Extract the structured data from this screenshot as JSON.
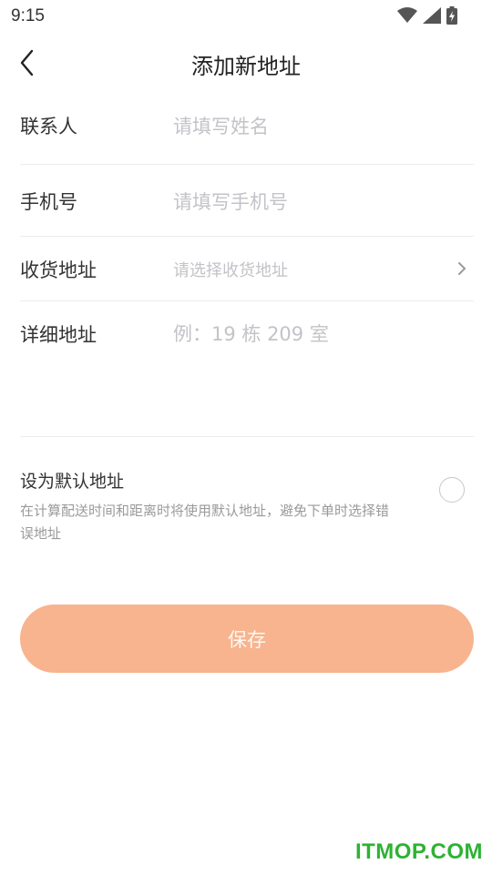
{
  "status_bar": {
    "time": "9:15",
    "icons": [
      "wifi-icon",
      "signal-icon",
      "battery-charging-icon"
    ]
  },
  "header": {
    "back_icon": "chevron-left-icon",
    "title": "添加新地址"
  },
  "form": {
    "name": {
      "label": "联系人",
      "placeholder": "请填写姓名",
      "value": ""
    },
    "phone": {
      "label": "手机号",
      "placeholder": "请填写手机号",
      "value": ""
    },
    "region": {
      "label": "收货地址",
      "placeholder": "请选择收货地址",
      "icon": "chevron-right-icon"
    },
    "detail": {
      "label": "详细地址",
      "placeholder": "例：19 栋 209 室",
      "value": ""
    }
  },
  "default_address": {
    "title": "设为默认地址",
    "description": "在计算配送时间和距离时将使用默认地址，避免下单时选择错误地址",
    "checked": false
  },
  "save_button": {
    "label": "保存",
    "color": "#f7b48e"
  },
  "watermark": "ITMOP.COM",
  "colors": {
    "accent": "#f7b48e",
    "placeholder": "#c3c3c8",
    "divider": "#ececec",
    "watermark": "#2eb233"
  }
}
